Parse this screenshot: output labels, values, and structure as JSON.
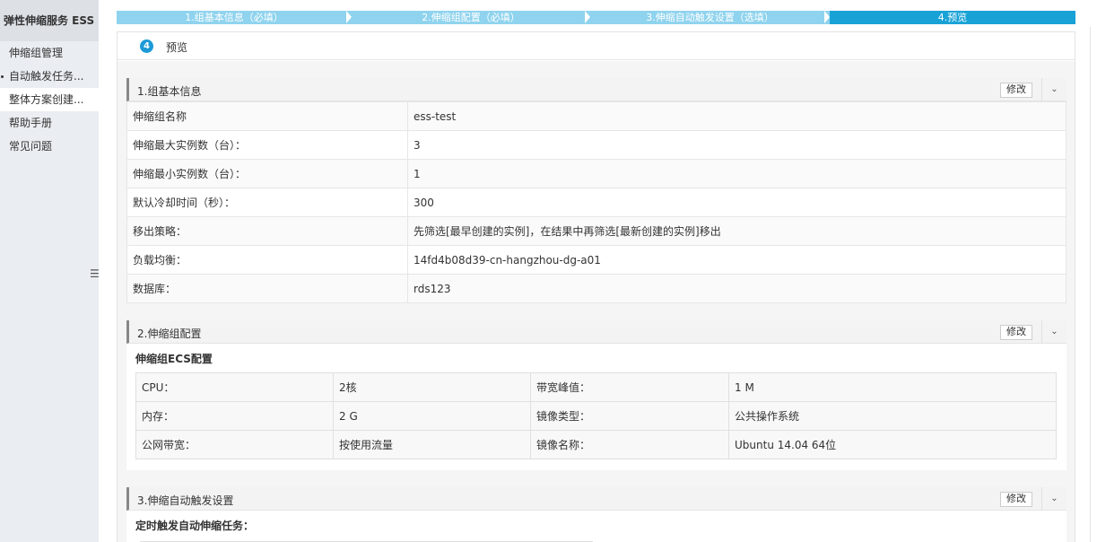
{
  "sidebar": {
    "title": "弹性伸缩服务 ESS",
    "items": [
      {
        "label": "伸缩组管理",
        "active": false
      },
      {
        "label": "自动触发任务...",
        "active": false
      },
      {
        "label": "整体方案创建...",
        "active": true
      },
      {
        "label": "帮助手册",
        "active": false
      },
      {
        "label": "常见问题",
        "active": false
      }
    ],
    "collapse_icon": "menu-icon"
  },
  "steps": [
    {
      "label": "1.组基本信息（必填）",
      "active": false
    },
    {
      "label": "2.伸缩组配置（必填）",
      "active": false
    },
    {
      "label": "3.伸缩自动触发设置（选填）",
      "active": false
    },
    {
      "label": "4.预览",
      "active": true
    }
  ],
  "preview": {
    "badge": "4",
    "title": "预览"
  },
  "section1": {
    "title": "1.组基本信息",
    "edit_label": "修改",
    "rows": [
      {
        "key": "伸缩组名称",
        "value": "ess-test"
      },
      {
        "key": "伸缩最大实例数（台）：",
        "value": "3"
      },
      {
        "key": "伸缩最小实例数（台）：",
        "value": "1"
      },
      {
        "key": "默认冷却时间（秒）：",
        "value": "300"
      },
      {
        "key": "移出策略：",
        "value": "先筛选[最早创建的实例]，在结果中再筛选[最新创建的实例]移出"
      },
      {
        "key": "负载均衡：",
        "value": "14fd4b08d39-cn-hangzhou-dg-a01"
      },
      {
        "key": "数据库：",
        "value": "rds123"
      }
    ]
  },
  "section2": {
    "title": "2.伸缩组配置",
    "edit_label": "修改",
    "subtitle": "伸缩组ECS配置",
    "rows": [
      [
        "CPU：",
        "2核",
        "带宽峰值：",
        "1 M"
      ],
      [
        "内存：",
        "2 G",
        "镜像类型：",
        "公共操作系统"
      ],
      [
        "公网带宽：",
        "按使用流量",
        "镜像名称：",
        "Ubuntu 14.04 64位"
      ]
    ]
  },
  "section3": {
    "title": "3.伸缩自动触发设置",
    "edit_label": "修改",
    "subtitle": "定时触发自动伸缩任务："
  },
  "colors": {
    "step_inactive": "#8fd3ee",
    "step_active": "#18a2d6",
    "badge": "#1c9ad6",
    "sidebar_bg": "#eaedf1"
  }
}
